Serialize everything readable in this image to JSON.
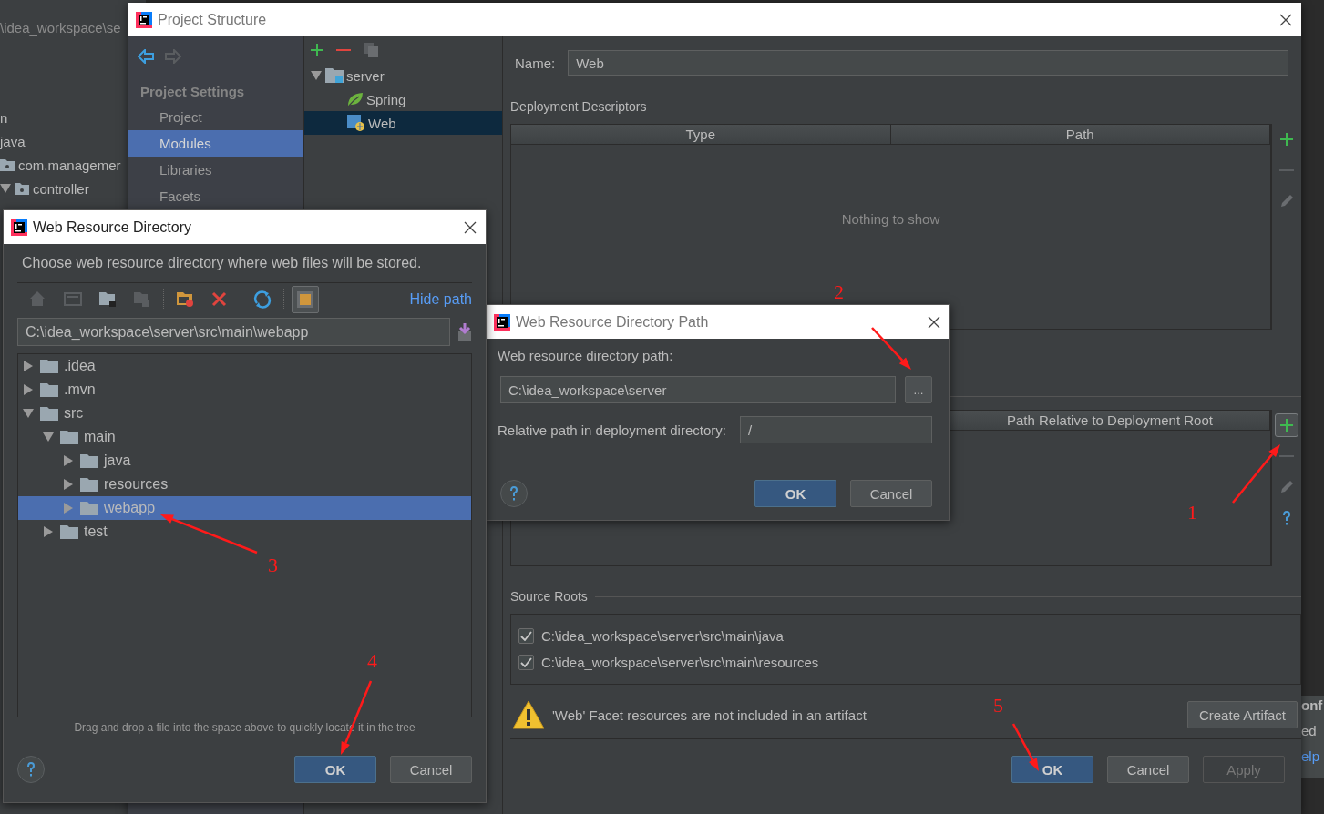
{
  "ide_background": {
    "path_fragment": "\\idea_workspace\\se",
    "tree_fragments": [
      {
        "label": "n",
        "kind": "plain"
      },
      {
        "label": "java",
        "kind": "plain"
      },
      {
        "label": "com.managemer",
        "kind": "package"
      },
      {
        "label": "controller",
        "kind": "package",
        "expanded": true
      }
    ],
    "right_fragments": [
      {
        "text": "onf",
        "kind": "heading"
      },
      {
        "text": "ed",
        "kind": "text"
      },
      {
        "text": "elp",
        "kind": "link"
      }
    ]
  },
  "project_structure": {
    "title": "Project Structure",
    "active": false,
    "sidebar": {
      "heading": "Project Settings",
      "items": [
        {
          "label": "Project",
          "selected": false
        },
        {
          "label": "Modules",
          "selected": true
        },
        {
          "label": "Libraries",
          "selected": false
        },
        {
          "label": "Facets",
          "selected": false
        }
      ]
    },
    "module_tree": [
      {
        "label": "server",
        "kind": "module",
        "expanded": true,
        "selected": false,
        "children": [
          {
            "label": "Spring",
            "kind": "spring",
            "selected": false
          },
          {
            "label": "Web",
            "kind": "web",
            "selected": true
          }
        ]
      }
    ],
    "name_label": "Name:",
    "name_value": "Web",
    "deployment_descriptors": {
      "title": "Deployment Descriptors",
      "columns": [
        "Type",
        "Path"
      ],
      "empty_text": "Nothing to show",
      "side_toolbar": [
        {
          "kind": "add",
          "highlighted": false
        },
        {
          "kind": "remove",
          "highlighted": false
        },
        {
          "kind": "edit",
          "highlighted": false
        }
      ]
    },
    "web_resource_directories": {
      "visible_column": "Path Relative to Deployment Root",
      "side_toolbar": [
        {
          "kind": "add",
          "highlighted": true
        },
        {
          "kind": "remove",
          "highlighted": false
        },
        {
          "kind": "edit",
          "highlighted": false
        },
        {
          "kind": "help",
          "highlighted": false
        }
      ]
    },
    "source_roots": {
      "title": "Source Roots",
      "items": [
        {
          "path": "C:\\idea_workspace\\server\\src\\main\\java",
          "checked": true
        },
        {
          "path": "C:\\idea_workspace\\server\\src\\main\\resources",
          "checked": true
        }
      ]
    },
    "warning": {
      "text": "'Web' Facet resources are not included in an artifact",
      "button": "Create Artifact"
    },
    "buttons": [
      {
        "label": "OK",
        "kind": "default",
        "disabled": false
      },
      {
        "label": "Cancel",
        "kind": "normal",
        "disabled": false
      },
      {
        "label": "Apply",
        "kind": "normal",
        "disabled": true
      }
    ]
  },
  "directory_path_dialog": {
    "title": "Web Resource Directory Path",
    "active": false,
    "path_label": "Web resource directory path:",
    "path_value": "C:\\idea_workspace\\server",
    "browse_button": "...",
    "relative_label": "Relative path in deployment directory:",
    "relative_value": "/",
    "buttons": [
      {
        "label": "OK",
        "kind": "default",
        "disabled": false
      },
      {
        "label": "Cancel",
        "kind": "normal",
        "disabled": false
      }
    ]
  },
  "resource_directory_dialog": {
    "title": "Web Resource Directory",
    "active": true,
    "description": "Choose web resource directory where web files will be stored.",
    "toolbar": [
      {
        "kind": "home",
        "selected": false
      },
      {
        "kind": "desktop",
        "selected": false
      },
      {
        "kind": "project-folder",
        "selected": false
      },
      {
        "kind": "module-folder",
        "selected": false
      },
      {
        "kind": "new-folder",
        "selected": false
      },
      {
        "kind": "delete",
        "selected": false
      },
      {
        "kind": "refresh",
        "selected": false
      },
      {
        "kind": "show-hidden",
        "selected": true
      }
    ],
    "hide_path_link": "Hide path",
    "path_value": "C:\\idea_workspace\\server\\src\\main\\webapp",
    "tree": [
      {
        "label": ".idea",
        "expanded": false,
        "selected": false
      },
      {
        "label": ".mvn",
        "expanded": false,
        "selected": false
      },
      {
        "label": "src",
        "expanded": true,
        "selected": false,
        "children": [
          {
            "label": "main",
            "expanded": true,
            "selected": false,
            "children": [
              {
                "label": "java",
                "expanded": false,
                "selected": false
              },
              {
                "label": "resources",
                "expanded": false,
                "selected": false
              },
              {
                "label": "webapp",
                "expanded": false,
                "selected": true
              }
            ]
          },
          {
            "label": "test",
            "expanded": false,
            "selected": false
          }
        ]
      }
    ],
    "hint": "Drag and drop a file into the space above to quickly locate it in the tree",
    "buttons": [
      {
        "label": "OK",
        "kind": "default",
        "disabled": false
      },
      {
        "label": "Cancel",
        "kind": "normal",
        "disabled": false
      }
    ]
  },
  "annotations": [
    {
      "label": "1"
    },
    {
      "label": "2"
    },
    {
      "label": "3"
    },
    {
      "label": "4"
    },
    {
      "label": "5"
    }
  ]
}
